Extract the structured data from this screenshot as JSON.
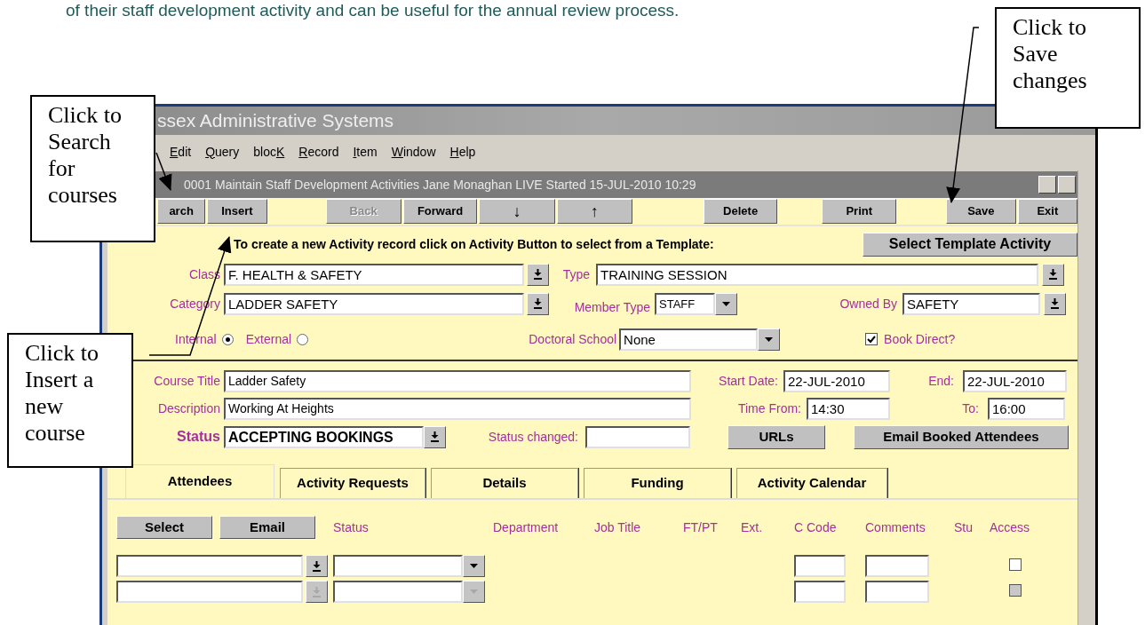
{
  "intro_text": "of their staff development activity and can be useful for the annual review process.",
  "callouts": [
    {
      "kind": "search",
      "lines": [
        "Click to",
        "Search",
        "for",
        "courses"
      ]
    },
    {
      "kind": "insert",
      "lines": [
        "Click to",
        "Insert a",
        "new",
        "course"
      ]
    },
    {
      "kind": "save",
      "lines": [
        "Click to",
        "Save",
        "changes"
      ]
    }
  ],
  "window": {
    "title": "ssex Administrative Systems",
    "menu": [
      {
        "key": "E",
        "after": "dit"
      },
      {
        "key": "Q",
        "after": "uery"
      },
      {
        "before": "bloc",
        "key": "K"
      },
      {
        "key": "R",
        "after": "ecord"
      },
      {
        "key": "I",
        "after": "tem"
      },
      {
        "key": "W",
        "after": "indow"
      },
      {
        "key": "H",
        "after": "elp"
      }
    ],
    "form_title": "0001 Maintain Staff Development Activities  Jane Monaghan LIVE  Started 15-JUL-2010 10:29"
  },
  "toolbar": [
    {
      "label": "arch",
      "disabled": false
    },
    {
      "label": "Insert",
      "disabled": false
    },
    {
      "label": "Back",
      "disabled": true
    },
    {
      "label": "Forward",
      "disabled": false
    },
    {
      "label": "↓",
      "disabled": false
    },
    {
      "label": "↑",
      "disabled": false
    },
    {
      "label": "Delete",
      "disabled": false
    },
    {
      "label": "Print",
      "disabled": false
    },
    {
      "label": "Save",
      "disabled": false
    },
    {
      "label": "Exit",
      "disabled": false
    }
  ],
  "form": {
    "instruction": "To create a new Activity record click on Activity Button to select from a Template:",
    "template_button": "Select Template Activity",
    "class": {
      "label": "Class",
      "value": "F. HEALTH & SAFETY"
    },
    "type": {
      "label": "Type",
      "value": "TRAINING SESSION"
    },
    "category": {
      "label": "Category",
      "value": "LADDER SAFETY"
    },
    "member_type": {
      "label": "Member Type",
      "value": "STAFF"
    },
    "owned_by": {
      "label": "Owned By",
      "value": "SAFETY"
    },
    "location": [
      {
        "label": "Internal",
        "selected": true
      },
      {
        "label": "External",
        "selected": false
      }
    ],
    "doctoral_school": {
      "label": "Doctoral School",
      "value": "None"
    },
    "book_direct": {
      "label": "Book Direct?",
      "checked": true
    },
    "course_title": {
      "label": "Course Title",
      "value": "Ladder Safety"
    },
    "start_date": {
      "label": "Start Date:",
      "value": "22-JUL-2010"
    },
    "end_date": {
      "label": "End:",
      "value": "22-JUL-2010"
    },
    "description": {
      "label": "Description",
      "value": "Working At Heights"
    },
    "time_from": {
      "label": "Time From:",
      "value": "14:30"
    },
    "time_to": {
      "label": "To:",
      "value": "16:00"
    },
    "status": {
      "label": "Status",
      "value": "ACCEPTING BOOKINGS"
    },
    "status_changed": {
      "label": "Status changed:"
    },
    "buttons": [
      "URLs",
      "Email Booked Attendees"
    ]
  },
  "tabs": [
    {
      "label": "Attendees",
      "selected": true
    },
    {
      "label": "Activity Requests",
      "selected": false
    },
    {
      "label": "Details",
      "selected": false
    },
    {
      "label": "Funding",
      "selected": false
    },
    {
      "label": "Activity Calendar",
      "selected": false
    }
  ],
  "attendees": {
    "buttons": [
      "Select",
      "Email"
    ],
    "columns": [
      "Status",
      "Department",
      "Job Title",
      "FT/PT",
      "Ext.",
      "C Code",
      "Comments",
      "Stu",
      "Access"
    ],
    "rows": [
      {
        "disabled": false,
        "access_checked": false
      },
      {
        "disabled": true,
        "access_checked": false
      }
    ]
  }
}
